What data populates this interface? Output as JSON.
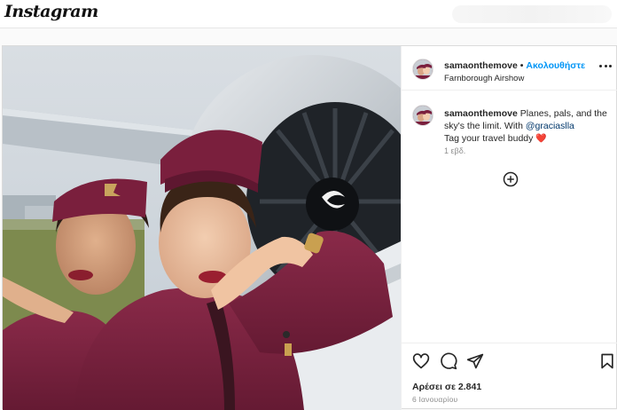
{
  "app": {
    "logo_text": "Instagram"
  },
  "post": {
    "author": {
      "username": "samaonthemove",
      "separator": "•",
      "follow_label": "Ακολουθήστε",
      "location": "Farnborough Airshow"
    },
    "caption": {
      "username": "samaonthemove",
      "text_part1": "Planes, pals, and the sky's the limit. With",
      "mention": "@graciaslla",
      "text_part2": "Tag your travel buddy",
      "emoji": "❤️",
      "time": "1 εβδ."
    },
    "likes_text": "Αρέσει σε 2.841",
    "date_text": "6 Ιανουαρίου",
    "icons": {
      "more": "more-options-icon",
      "load_more": "plus-circle-icon",
      "like": "heart-icon",
      "comment": "comment-icon",
      "share": "send-icon",
      "save": "bookmark-icon"
    },
    "colors": {
      "uniform": "#7a1f3d",
      "follow": "#0095f6",
      "heart": "#ed4956"
    }
  }
}
